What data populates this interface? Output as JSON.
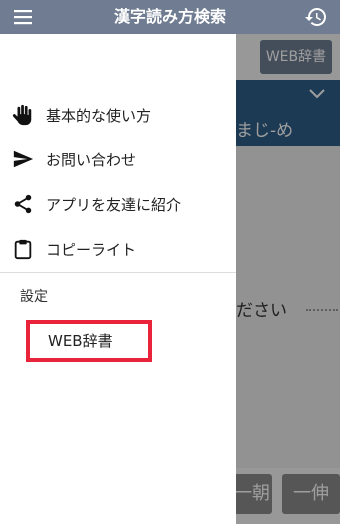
{
  "app": {
    "title": "漢字読み方検索"
  },
  "background": {
    "web_dict_button": "WEB辞書",
    "reading_text": "まじ-め",
    "hint_text": "ださい",
    "kanji_buttons": [
      "一朝",
      "一伸"
    ]
  },
  "drawer": {
    "items": [
      {
        "label": "基本的な使い方",
        "icon": "hand-icon"
      },
      {
        "label": "お問い合わせ",
        "icon": "send-icon"
      },
      {
        "label": "アプリを友達に紹介",
        "icon": "share-icon"
      },
      {
        "label": "コピーライト",
        "icon": "clipboard-icon"
      }
    ],
    "section_label": "設定",
    "settings_item": "WEB辞書"
  },
  "colors": {
    "topbar": "#6f7c91",
    "panel": "#2f5e88",
    "highlight": "#e8233a"
  }
}
